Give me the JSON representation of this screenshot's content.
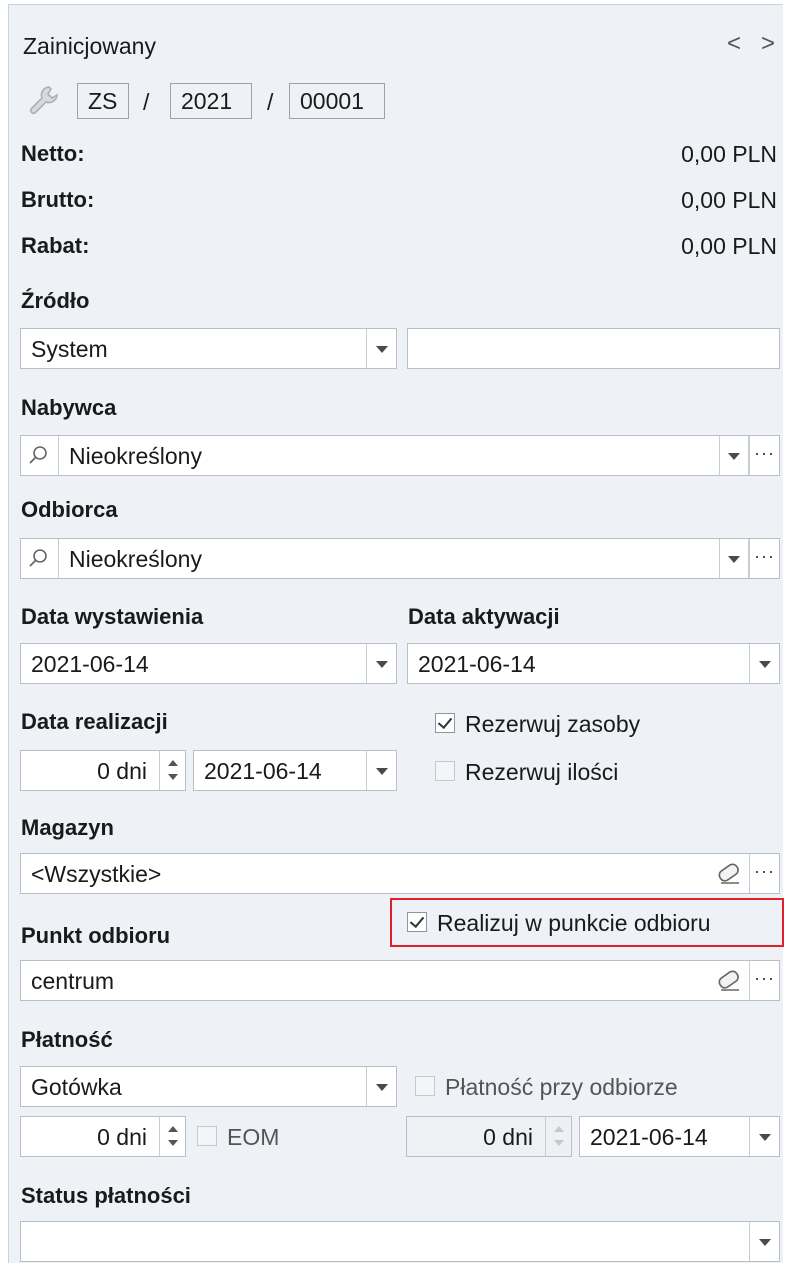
{
  "header": {
    "status": "Zainicjowany",
    "nav_prev": "<",
    "nav_next": ">",
    "number_prefix": "ZS",
    "number_year": "2021",
    "number_seq": "00001",
    "slash": "/"
  },
  "totals": [
    {
      "label": "Netto:",
      "value": "0,00 PLN"
    },
    {
      "label": "Brutto:",
      "value": "0,00 PLN"
    },
    {
      "label": "Rabat:",
      "value": "0,00 PLN"
    }
  ],
  "zrodlo": {
    "label": "Źródło",
    "value": "System",
    "extra": ""
  },
  "nabywca": {
    "label": "Nabywca",
    "value": "Nieokreślony",
    "more": "···"
  },
  "odbiorca": {
    "label": "Odbiorca",
    "value": "Nieokreślony",
    "more": "···"
  },
  "data_wystawienia": {
    "label": "Data wystawienia",
    "value": "2021-06-14"
  },
  "data_aktywacji": {
    "label": "Data aktywacji",
    "value": "2021-06-14"
  },
  "data_realizacji": {
    "label": "Data realizacji",
    "days": "0 dni",
    "date": "2021-06-14"
  },
  "rezerwuj_zasoby": {
    "label": "Rezerwuj zasoby",
    "checked": true
  },
  "rezerwuj_ilosci": {
    "label": "Rezerwuj ilości",
    "checked": false
  },
  "magazyn": {
    "label": "Magazyn",
    "value": "<Wszystkie>",
    "more": "···"
  },
  "punkt_odbioru": {
    "label": "Punkt odbioru",
    "value": "centrum",
    "more": "···"
  },
  "realizuj_w_punkcie": {
    "label": "Realizuj w punkcie odbioru",
    "checked": true,
    "highlight_color": "#e0202a"
  },
  "platnosc": {
    "label": "Płatność",
    "value": "Gotówka",
    "days": "0 dni",
    "eom_label": "EOM",
    "eom_checked": false
  },
  "platnosc_przy_odbiorze": {
    "label": "Płatność przy odbiorze",
    "checked": false,
    "days": "0 dni",
    "date": "2021-06-14"
  },
  "status_platnosci": {
    "label": "Status płatności",
    "value": ""
  },
  "colors": {
    "panel_bg": "#eef2f7",
    "field_border": "#b9bfc7",
    "highlight": "#e0202a"
  }
}
